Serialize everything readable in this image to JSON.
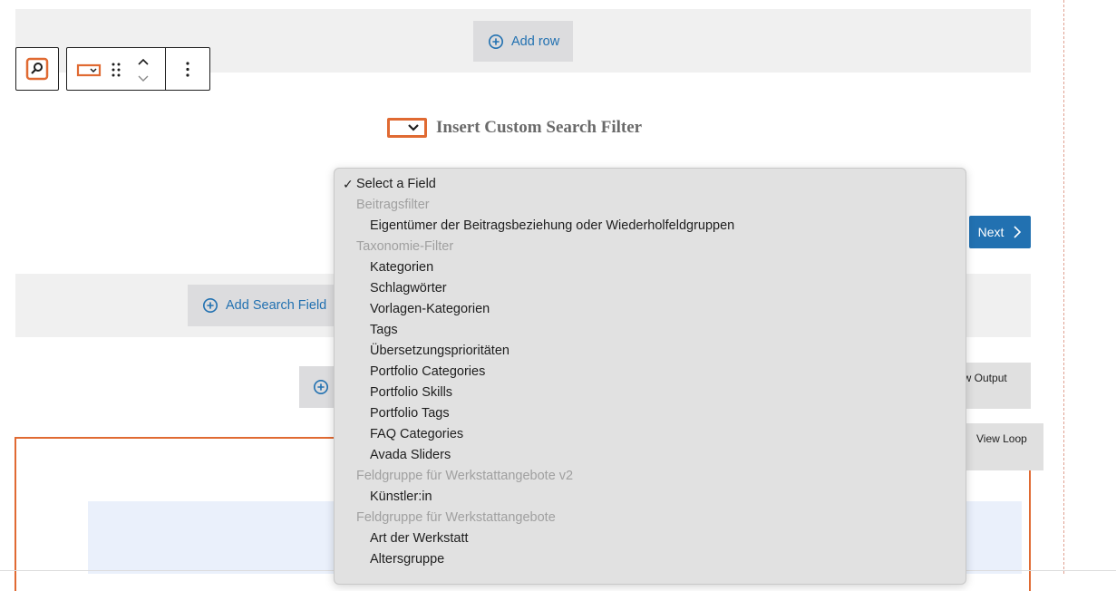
{
  "top_band": {
    "add_row_label": "Add row"
  },
  "block_heading": {
    "title": "Insert Custom Search Filter"
  },
  "add_search_field_label": "Add Search Field",
  "next_label": "Next",
  "view_output_label": "ew Output",
  "view_loop_label": "View Loop",
  "colors": {
    "accent": "#e06a32",
    "link": "#2271b1",
    "primary_button": "#2271b1"
  },
  "dropdown": {
    "selected": "Select a Field",
    "options": [
      {
        "kind": "group",
        "label": "Beitragsfilter"
      },
      {
        "kind": "item",
        "label": "Eigentümer der Beitragsbeziehung oder Wiederholfeldgruppen"
      },
      {
        "kind": "group",
        "label": "Taxonomie-Filter"
      },
      {
        "kind": "item",
        "label": "Kategorien"
      },
      {
        "kind": "item",
        "label": "Schlagwörter"
      },
      {
        "kind": "item",
        "label": "Vorlagen-Kategorien"
      },
      {
        "kind": "item",
        "label": "Tags"
      },
      {
        "kind": "item",
        "label": "Übersetzungsprioritäten"
      },
      {
        "kind": "item",
        "label": "Portfolio Categories"
      },
      {
        "kind": "item",
        "label": "Portfolio Skills"
      },
      {
        "kind": "item",
        "label": "Portfolio Tags"
      },
      {
        "kind": "item",
        "label": "FAQ Categories"
      },
      {
        "kind": "item",
        "label": "Avada Sliders"
      },
      {
        "kind": "group",
        "label": "Feldgruppe für Werkstattangebote v2"
      },
      {
        "kind": "item",
        "label": "Künstler:in"
      },
      {
        "kind": "group",
        "label": "Feldgruppe für Werkstattangebote"
      },
      {
        "kind": "item",
        "label": "Art der Werkstatt"
      },
      {
        "kind": "item",
        "label": "Altersgruppe"
      }
    ]
  }
}
